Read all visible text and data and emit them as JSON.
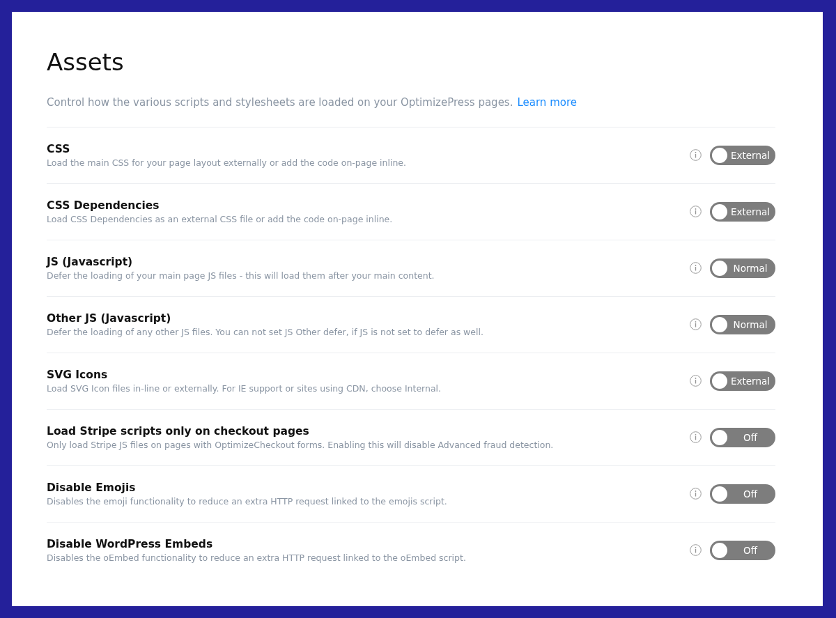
{
  "title": "Assets",
  "intro": {
    "text": "Control how the various scripts and stylesheets are loaded on your OptimizePress pages.",
    "link": "Learn more"
  },
  "settings": [
    {
      "label": "CSS",
      "description": "Load the main CSS for your page layout externally or add the code on-page inline.",
      "toggle": {
        "text": "External",
        "on": false
      }
    },
    {
      "label": "CSS Dependencies",
      "description": "Load CSS Dependencies as an external CSS file or add the code on-page inline.",
      "toggle": {
        "text": "External",
        "on": false
      }
    },
    {
      "label": "JS (Javascript)",
      "description": "Defer the loading of your main page JS files - this will load them after your main content.",
      "toggle": {
        "text": "Normal",
        "on": false
      }
    },
    {
      "label": "Other JS (Javascript)",
      "description": "Defer the loading of any other JS files. You can not set JS Other defer, if JS is not set to defer as well.",
      "toggle": {
        "text": "Normal",
        "on": false
      }
    },
    {
      "label": "SVG Icons",
      "description": "Load SVG Icon files in-line or externally. For IE support or sites using CDN, choose Internal.",
      "toggle": {
        "text": "External",
        "on": false
      }
    },
    {
      "label": "Load Stripe scripts only on checkout pages",
      "description": "Only load Stripe JS files on pages with OptimizeCheckout forms. Enabling this will disable Advanced fraud detection.",
      "toggle": {
        "text": "Off",
        "on": false
      }
    },
    {
      "label": "Disable Emojis",
      "description": "Disables the emoji functionality to reduce an extra HTTP request linked to the emojis script.",
      "toggle": {
        "text": "Off",
        "on": false
      }
    },
    {
      "label": "Disable WordPress Embeds",
      "description": "Disables the oEmbed functionality to reduce an extra HTTP request linked to the oEmbed script.",
      "toggle": {
        "text": "Off",
        "on": false
      }
    }
  ]
}
